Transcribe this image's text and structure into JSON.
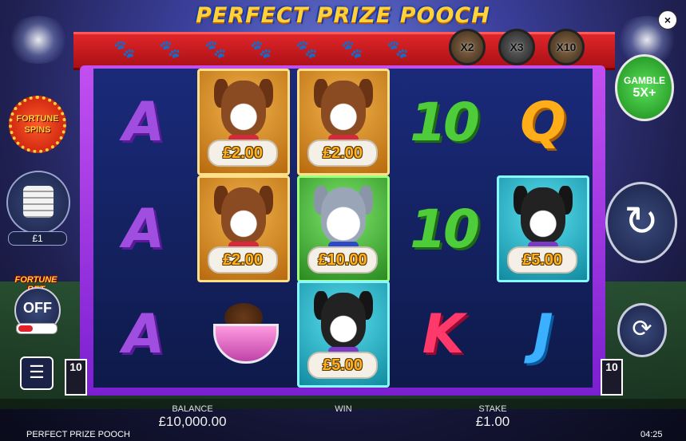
{
  "game": {
    "title": "PERFECT PRIZE POOCH",
    "footer_title": "PERFECT PRIZE POOCH",
    "clock": "04:25"
  },
  "header": {
    "close_label": "×"
  },
  "banner": {
    "paw_icon": "🐾",
    "multipliers": [
      "X2",
      "X3",
      "X10"
    ]
  },
  "reels": [
    [
      {
        "type": "letter",
        "symbol": "A",
        "style": "A"
      },
      {
        "type": "letter",
        "symbol": "A",
        "style": "A"
      },
      {
        "type": "letter",
        "symbol": "A",
        "style": "A"
      }
    ],
    [
      {
        "type": "dog",
        "style": "gold",
        "prize": "£2.00"
      },
      {
        "type": "dog",
        "style": "gold",
        "prize": "£2.00"
      },
      {
        "type": "bowl"
      }
    ],
    [
      {
        "type": "dog",
        "style": "gold",
        "prize": "£2.00"
      },
      {
        "type": "dog",
        "style": "green",
        "prize": "£10.00"
      },
      {
        "type": "dog",
        "style": "teal",
        "prize": "£5.00"
      }
    ],
    [
      {
        "type": "letter",
        "symbol": "10",
        "style": "ten"
      },
      {
        "type": "letter",
        "symbol": "10",
        "style": "ten"
      },
      {
        "type": "letter",
        "symbol": "K",
        "style": "K"
      }
    ],
    [
      {
        "type": "letter",
        "symbol": "Q",
        "style": "Q"
      },
      {
        "type": "dog",
        "style": "teal",
        "prize": "£5.00"
      },
      {
        "type": "letter",
        "symbol": "J",
        "style": "J"
      }
    ]
  ],
  "left_panel": {
    "fortune_spins": "FORTUNE SPINS",
    "coin_value": "£1",
    "fortune_bet_label": "FORTUNE BET",
    "fortune_bet_state": "OFF",
    "menu_icon": "☰"
  },
  "lines": {
    "left": "10",
    "right": "10"
  },
  "right_panel": {
    "gamble_line1": "GAMBLE",
    "gamble_line2": "5X+",
    "spin_icon": "↻",
    "autoplay_icon": "⟳"
  },
  "stats": {
    "balance_label": "BALANCE",
    "balance_value": "£10,000.00",
    "win_label": "WIN",
    "win_value": "",
    "stake_label": "STAKE",
    "stake_value": "£1.00"
  }
}
